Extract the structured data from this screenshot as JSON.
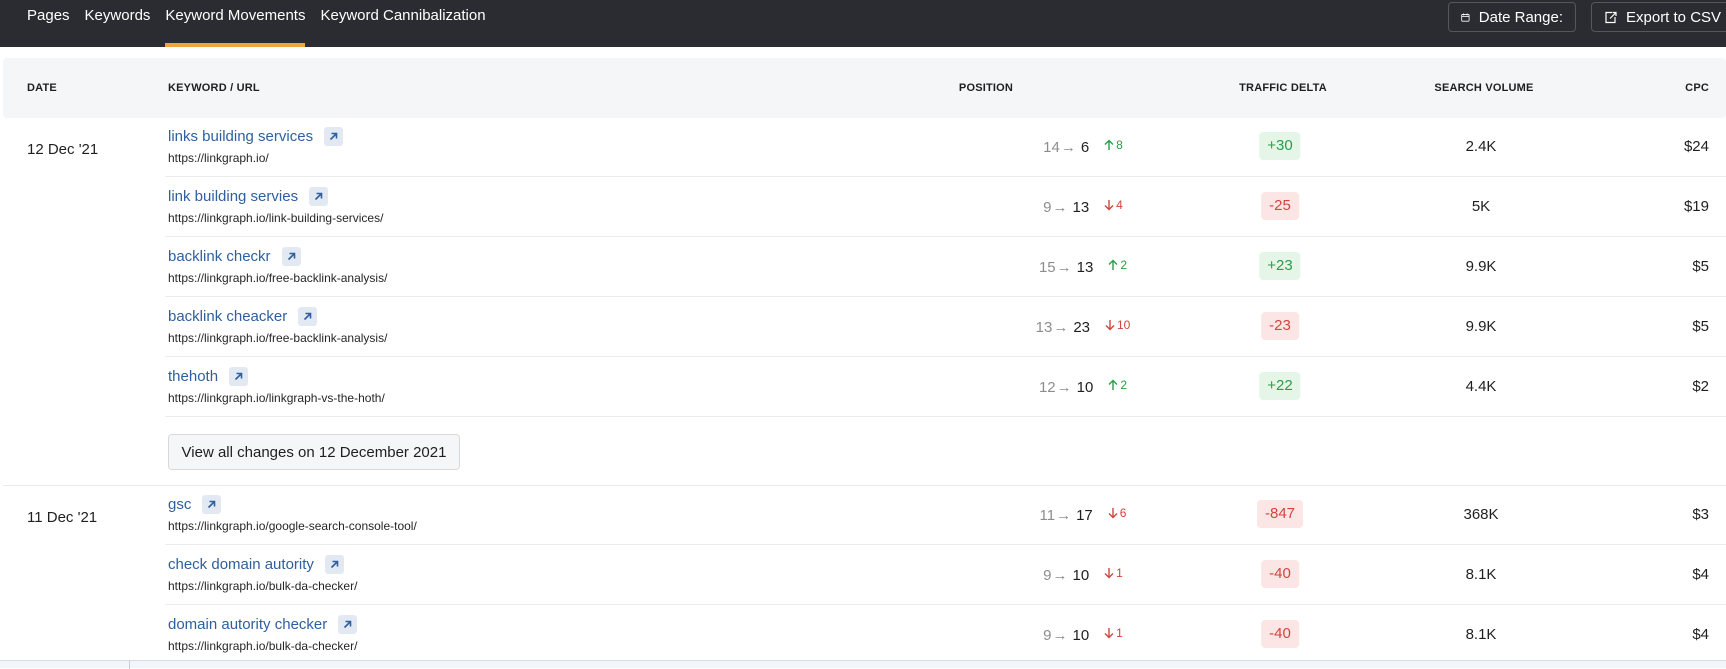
{
  "tabs": [
    {
      "label": "Pages",
      "active": false
    },
    {
      "label": "Keywords",
      "active": false
    },
    {
      "label": "Keyword Movements",
      "active": true
    },
    {
      "label": "Keyword Cannibalization",
      "active": false
    }
  ],
  "toolbar": {
    "date_range_label": "Date Range:",
    "date_range_icon": "calendar-icon",
    "export_label": "Export to CSV",
    "export_icon": "export-icon"
  },
  "columns": {
    "date": "DATE",
    "keyword_url": "KEYWORD / URL",
    "position": "POSITION",
    "traffic_delta": "TRAFFIC DELTA",
    "search_volume": "SEARCH VOLUME",
    "cpc": "CPC"
  },
  "colors": {
    "accent_tab_underline": "#f0a43c",
    "link": "#2f5f9e",
    "positive": "#2a9d4a",
    "negative": "#d0453f"
  },
  "groups": [
    {
      "date": "12 Dec '21",
      "view_all_label": "View all changes on 12 December 2021",
      "rows": [
        {
          "keyword": "links building services",
          "url": "https://linkgraph.io/",
          "pos_from": "14",
          "pos_to": "6",
          "direction": "up",
          "change": "8",
          "traffic_delta": "+30",
          "search_volume": "2.4K",
          "cpc": "$24"
        },
        {
          "keyword": "link building servies",
          "url": "https://linkgraph.io/link-building-services/",
          "pos_from": "9",
          "pos_to": "13",
          "direction": "down",
          "change": "4",
          "traffic_delta": "-25",
          "search_volume": "5K",
          "cpc": "$19"
        },
        {
          "keyword": "backlink checkr",
          "url": "https://linkgraph.io/free-backlink-analysis/",
          "pos_from": "15",
          "pos_to": "13",
          "direction": "up",
          "change": "2",
          "traffic_delta": "+23",
          "search_volume": "9.9K",
          "cpc": "$5"
        },
        {
          "keyword": "backlink cheacker",
          "url": "https://linkgraph.io/free-backlink-analysis/",
          "pos_from": "13",
          "pos_to": "23",
          "direction": "down",
          "change": "10",
          "traffic_delta": "-23",
          "search_volume": "9.9K",
          "cpc": "$5"
        },
        {
          "keyword": "thehoth",
          "url": "https://linkgraph.io/linkgraph-vs-the-hoth/",
          "pos_from": "12",
          "pos_to": "10",
          "direction": "up",
          "change": "2",
          "traffic_delta": "+22",
          "search_volume": "4.4K",
          "cpc": "$2"
        }
      ]
    },
    {
      "date": "11 Dec '21",
      "rows": [
        {
          "keyword": "gsc",
          "url": "https://linkgraph.io/google-search-console-tool/",
          "pos_from": "11",
          "pos_to": "17",
          "direction": "down",
          "change": "6",
          "traffic_delta": "-847",
          "search_volume": "368K",
          "cpc": "$3"
        },
        {
          "keyword": "check domain autority",
          "url": "https://linkgraph.io/bulk-da-checker/",
          "pos_from": "9",
          "pos_to": "10",
          "direction": "down",
          "change": "1",
          "traffic_delta": "-40",
          "search_volume": "8.1K",
          "cpc": "$4"
        },
        {
          "keyword": "domain autority checker",
          "url": "https://linkgraph.io/bulk-da-checker/",
          "pos_from": "9",
          "pos_to": "10",
          "direction": "down",
          "change": "1",
          "traffic_delta": "-40",
          "search_volume": "8.1K",
          "cpc": "$4"
        }
      ]
    }
  ]
}
